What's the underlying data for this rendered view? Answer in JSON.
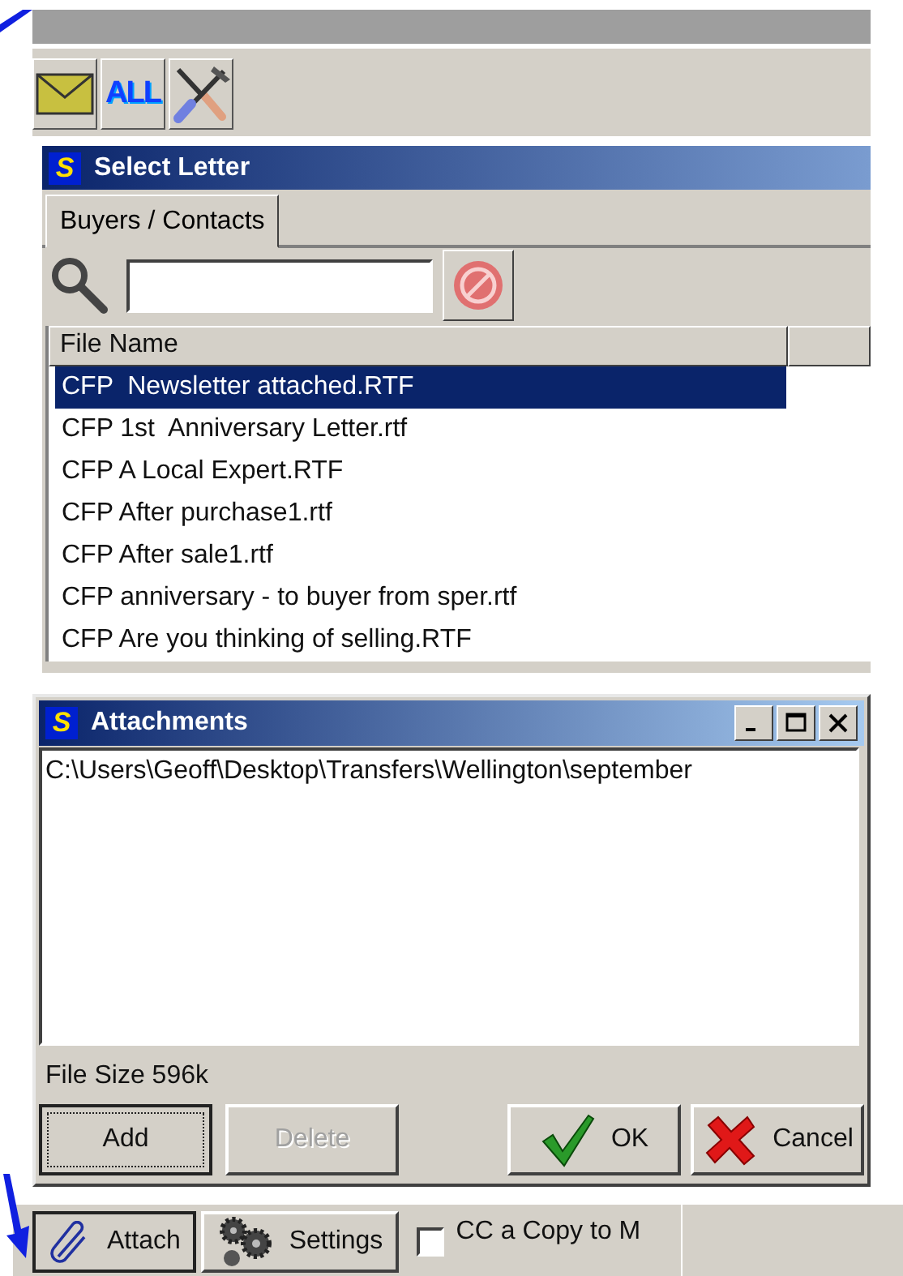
{
  "toolbar": {
    "buttons": [
      {
        "kind": "envelope"
      },
      {
        "kind": "text",
        "label": "ALL"
      },
      {
        "kind": "tools"
      }
    ]
  },
  "select_letter": {
    "title": "Select Letter",
    "app_icon": "S",
    "tabs": [
      {
        "label": "Buyers / Contacts",
        "selected": true
      }
    ],
    "columns": [
      "File Name"
    ],
    "rows": [
      {
        "file_name": "CFP  Newsletter attached.RTF",
        "selected": true
      },
      {
        "file_name": "CFP 1st  Anniversary Letter.rtf",
        "selected": false
      },
      {
        "file_name": "CFP A Local Expert.RTF",
        "selected": false
      },
      {
        "file_name": "CFP After purchase1.rtf",
        "selected": false
      },
      {
        "file_name": "CFP After sale1.rtf",
        "selected": false
      },
      {
        "file_name": "CFP anniversary - to buyer from sper.rtf",
        "selected": false
      },
      {
        "file_name": "CFP Are you thinking of selling.RTF",
        "selected": false
      }
    ]
  },
  "attachments": {
    "title": "Attachments",
    "app_icon": "S",
    "files": [
      "C:\\Users\\Geoff\\Desktop\\Transfers\\Wellington\\september"
    ],
    "file_size": "File Size 596k",
    "buttons": [
      {
        "label": "Add",
        "kind": "plain",
        "focused": true,
        "disabled": false
      },
      {
        "label": "Delete",
        "kind": "plain",
        "focused": false,
        "disabled": true
      },
      {
        "label": "OK",
        "kind": "ok",
        "focused": false,
        "disabled": false
      },
      {
        "label": "Cancel",
        "kind": "cancel",
        "focused": false,
        "disabled": false
      }
    ]
  },
  "bottom_bar": {
    "buttons": [
      {
        "label": "Attach",
        "kind": "attach",
        "pressed": true
      },
      {
        "label": "Settings",
        "kind": "settings",
        "pressed": false
      }
    ],
    "cc_copy": {
      "label": "CC a Copy to M",
      "checked": false
    }
  }
}
